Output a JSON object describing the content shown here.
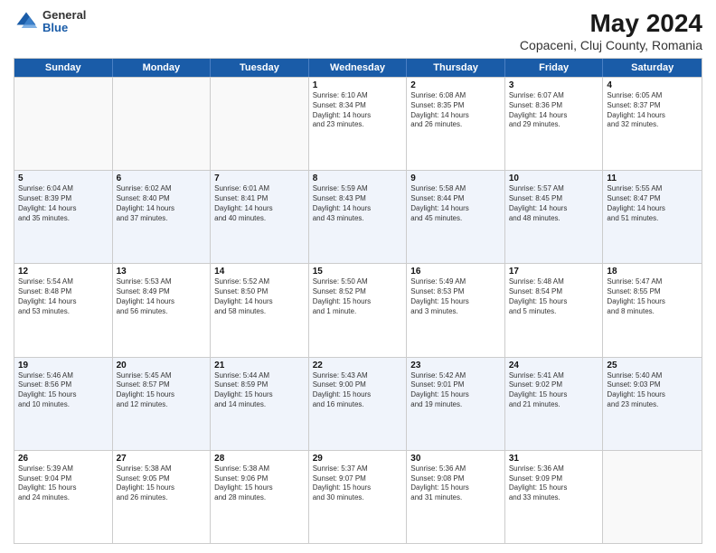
{
  "logo": {
    "general": "General",
    "blue": "Blue"
  },
  "title": "May 2024",
  "subtitle": "Copaceni, Cluj County, Romania",
  "header_days": [
    "Sunday",
    "Monday",
    "Tuesday",
    "Wednesday",
    "Thursday",
    "Friday",
    "Saturday"
  ],
  "weeks": [
    [
      {
        "day": "",
        "info": ""
      },
      {
        "day": "",
        "info": ""
      },
      {
        "day": "",
        "info": ""
      },
      {
        "day": "1",
        "info": "Sunrise: 6:10 AM\nSunset: 8:34 PM\nDaylight: 14 hours\nand 23 minutes."
      },
      {
        "day": "2",
        "info": "Sunrise: 6:08 AM\nSunset: 8:35 PM\nDaylight: 14 hours\nand 26 minutes."
      },
      {
        "day": "3",
        "info": "Sunrise: 6:07 AM\nSunset: 8:36 PM\nDaylight: 14 hours\nand 29 minutes."
      },
      {
        "day": "4",
        "info": "Sunrise: 6:05 AM\nSunset: 8:37 PM\nDaylight: 14 hours\nand 32 minutes."
      }
    ],
    [
      {
        "day": "5",
        "info": "Sunrise: 6:04 AM\nSunset: 8:39 PM\nDaylight: 14 hours\nand 35 minutes."
      },
      {
        "day": "6",
        "info": "Sunrise: 6:02 AM\nSunset: 8:40 PM\nDaylight: 14 hours\nand 37 minutes."
      },
      {
        "day": "7",
        "info": "Sunrise: 6:01 AM\nSunset: 8:41 PM\nDaylight: 14 hours\nand 40 minutes."
      },
      {
        "day": "8",
        "info": "Sunrise: 5:59 AM\nSunset: 8:43 PM\nDaylight: 14 hours\nand 43 minutes."
      },
      {
        "day": "9",
        "info": "Sunrise: 5:58 AM\nSunset: 8:44 PM\nDaylight: 14 hours\nand 45 minutes."
      },
      {
        "day": "10",
        "info": "Sunrise: 5:57 AM\nSunset: 8:45 PM\nDaylight: 14 hours\nand 48 minutes."
      },
      {
        "day": "11",
        "info": "Sunrise: 5:55 AM\nSunset: 8:47 PM\nDaylight: 14 hours\nand 51 minutes."
      }
    ],
    [
      {
        "day": "12",
        "info": "Sunrise: 5:54 AM\nSunset: 8:48 PM\nDaylight: 14 hours\nand 53 minutes."
      },
      {
        "day": "13",
        "info": "Sunrise: 5:53 AM\nSunset: 8:49 PM\nDaylight: 14 hours\nand 56 minutes."
      },
      {
        "day": "14",
        "info": "Sunrise: 5:52 AM\nSunset: 8:50 PM\nDaylight: 14 hours\nand 58 minutes."
      },
      {
        "day": "15",
        "info": "Sunrise: 5:50 AM\nSunset: 8:52 PM\nDaylight: 15 hours\nand 1 minute."
      },
      {
        "day": "16",
        "info": "Sunrise: 5:49 AM\nSunset: 8:53 PM\nDaylight: 15 hours\nand 3 minutes."
      },
      {
        "day": "17",
        "info": "Sunrise: 5:48 AM\nSunset: 8:54 PM\nDaylight: 15 hours\nand 5 minutes."
      },
      {
        "day": "18",
        "info": "Sunrise: 5:47 AM\nSunset: 8:55 PM\nDaylight: 15 hours\nand 8 minutes."
      }
    ],
    [
      {
        "day": "19",
        "info": "Sunrise: 5:46 AM\nSunset: 8:56 PM\nDaylight: 15 hours\nand 10 minutes."
      },
      {
        "day": "20",
        "info": "Sunrise: 5:45 AM\nSunset: 8:57 PM\nDaylight: 15 hours\nand 12 minutes."
      },
      {
        "day": "21",
        "info": "Sunrise: 5:44 AM\nSunset: 8:59 PM\nDaylight: 15 hours\nand 14 minutes."
      },
      {
        "day": "22",
        "info": "Sunrise: 5:43 AM\nSunset: 9:00 PM\nDaylight: 15 hours\nand 16 minutes."
      },
      {
        "day": "23",
        "info": "Sunrise: 5:42 AM\nSunset: 9:01 PM\nDaylight: 15 hours\nand 19 minutes."
      },
      {
        "day": "24",
        "info": "Sunrise: 5:41 AM\nSunset: 9:02 PM\nDaylight: 15 hours\nand 21 minutes."
      },
      {
        "day": "25",
        "info": "Sunrise: 5:40 AM\nSunset: 9:03 PM\nDaylight: 15 hours\nand 23 minutes."
      }
    ],
    [
      {
        "day": "26",
        "info": "Sunrise: 5:39 AM\nSunset: 9:04 PM\nDaylight: 15 hours\nand 24 minutes."
      },
      {
        "day": "27",
        "info": "Sunrise: 5:38 AM\nSunset: 9:05 PM\nDaylight: 15 hours\nand 26 minutes."
      },
      {
        "day": "28",
        "info": "Sunrise: 5:38 AM\nSunset: 9:06 PM\nDaylight: 15 hours\nand 28 minutes."
      },
      {
        "day": "29",
        "info": "Sunrise: 5:37 AM\nSunset: 9:07 PM\nDaylight: 15 hours\nand 30 minutes."
      },
      {
        "day": "30",
        "info": "Sunrise: 5:36 AM\nSunset: 9:08 PM\nDaylight: 15 hours\nand 31 minutes."
      },
      {
        "day": "31",
        "info": "Sunrise: 5:36 AM\nSunset: 9:09 PM\nDaylight: 15 hours\nand 33 minutes."
      },
      {
        "day": "",
        "info": ""
      }
    ]
  ]
}
